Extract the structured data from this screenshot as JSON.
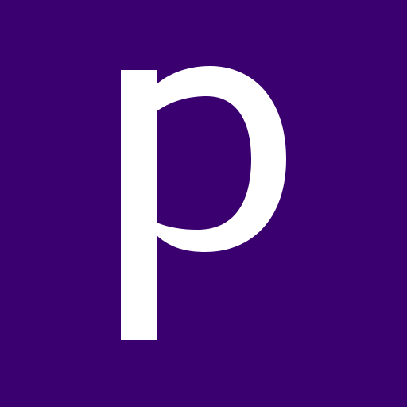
{
  "logo": {
    "letter": "p",
    "background_color": "#3a0070",
    "letter_color": "#ffffff"
  }
}
